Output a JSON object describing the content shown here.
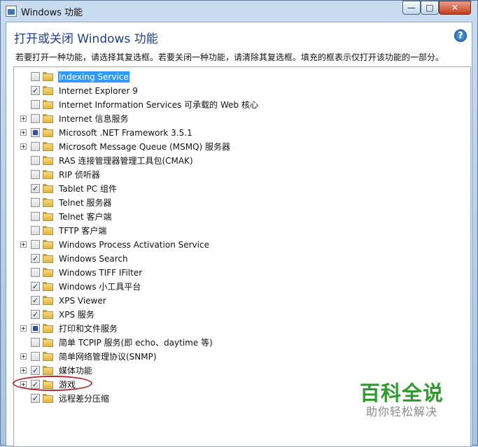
{
  "window": {
    "title": "Windows 功能",
    "controls": {
      "minimize": "—",
      "maximize": "□",
      "close": "✕"
    }
  },
  "header": {
    "heading": "打开或关闭 Windows 功能",
    "description": "若要打开一种功能，请选择其复选框。若要关闭一种功能，请清除其复选框。填充的框表示仅打开该功能的一部分。",
    "help": "?"
  },
  "features": [
    {
      "label": "Indexing Service",
      "state": "unchecked",
      "expandable": false,
      "selected": true
    },
    {
      "label": "Internet Explorer 9",
      "state": "checked",
      "expandable": false
    },
    {
      "label": "Internet Information Services 可承载的 Web 核心",
      "state": "unchecked",
      "expandable": false
    },
    {
      "label": "Internet 信息服务",
      "state": "unchecked",
      "expandable": true
    },
    {
      "label": "Microsoft .NET Framework 3.5.1",
      "state": "partial",
      "expandable": true
    },
    {
      "label": "Microsoft Message Queue (MSMQ) 服务器",
      "state": "unchecked",
      "expandable": true
    },
    {
      "label": "RAS 连接管理器管理工具包(CMAK)",
      "state": "unchecked",
      "expandable": false
    },
    {
      "label": "RIP 侦听器",
      "state": "unchecked",
      "expandable": false
    },
    {
      "label": "Tablet PC 组件",
      "state": "checked",
      "expandable": false
    },
    {
      "label": "Telnet 服务器",
      "state": "unchecked",
      "expandable": false
    },
    {
      "label": "Telnet 客户端",
      "state": "unchecked",
      "expandable": false
    },
    {
      "label": "TFTP 客户端",
      "state": "unchecked",
      "expandable": false
    },
    {
      "label": "Windows Process Activation Service",
      "state": "unchecked",
      "expandable": true
    },
    {
      "label": "Windows Search",
      "state": "checked",
      "expandable": false
    },
    {
      "label": "Windows TIFF IFilter",
      "state": "unchecked",
      "expandable": false
    },
    {
      "label": "Windows 小工具平台",
      "state": "checked",
      "expandable": false
    },
    {
      "label": "XPS Viewer",
      "state": "checked",
      "expandable": false
    },
    {
      "label": "XPS 服务",
      "state": "checked",
      "expandable": false
    },
    {
      "label": "打印和文件服务",
      "state": "partial",
      "expandable": true
    },
    {
      "label": "简单 TCPIP 服务(即 echo、daytime 等)",
      "state": "unchecked",
      "expandable": false
    },
    {
      "label": "简单网络管理协议(SNMP)",
      "state": "unchecked",
      "expandable": true
    },
    {
      "label": "媒体功能",
      "state": "checked",
      "expandable": true
    },
    {
      "label": "游戏",
      "state": "checked",
      "expandable": true
    },
    {
      "label": "远程差分压缩",
      "state": "checked",
      "expandable": false
    }
  ],
  "watermark": {
    "title": "百科全说",
    "subtitle": "助你轻松解决"
  },
  "colors": {
    "annotation": "#b3222a",
    "watermark": "#2e9b2e",
    "selection": "#3399ff"
  }
}
